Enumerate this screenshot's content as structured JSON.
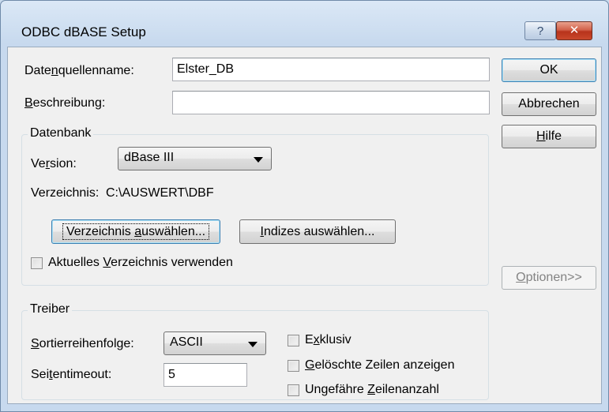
{
  "window": {
    "title": "ODBC dBASE Setup",
    "help_glyph": "?",
    "close_glyph": "✕"
  },
  "fields": {
    "datasource_label": [
      "Date",
      "n",
      "quellenname:"
    ],
    "datasource_value": "Elster_DB",
    "description_label": [
      "",
      "B",
      "eschreibung:"
    ],
    "description_value": ""
  },
  "buttons": {
    "ok": "OK",
    "cancel": "Abbrechen",
    "help": [
      "",
      "H",
      "ilfe"
    ],
    "options": [
      "",
      "O",
      "ptionen>>"
    ]
  },
  "database": {
    "group_title": "Datenbank",
    "version_label": [
      "Ve",
      "r",
      "sion:"
    ],
    "version_value": "dBase III",
    "directory_label": "Verzeichnis:",
    "directory_value": "C:\\AUSWERT\\DBF",
    "select_directory_button": [
      "Verzeichnis ",
      "a",
      "uswählen..."
    ],
    "select_indexes_button": [
      "",
      "I",
      "ndizes auswählen..."
    ],
    "use_current_directory": [
      "Aktuelles ",
      "V",
      "erzeichnis verwenden"
    ]
  },
  "driver": {
    "group_title": "Treiber",
    "sort_order_label": [
      "",
      "S",
      "ortierreihenfolge:"
    ],
    "sort_order_value": "ASCII",
    "page_timeout_label": [
      "Sei",
      "t",
      "entimeout:"
    ],
    "page_timeout_value": "5",
    "exclusive": [
      "E",
      "x",
      "klusiv"
    ],
    "show_deleted_rows": [
      "",
      "G",
      "elöschte Zeilen anzeigen"
    ],
    "approximate_row_count": [
      "Ungefähre ",
      "Z",
      "eilenanzahl"
    ]
  }
}
